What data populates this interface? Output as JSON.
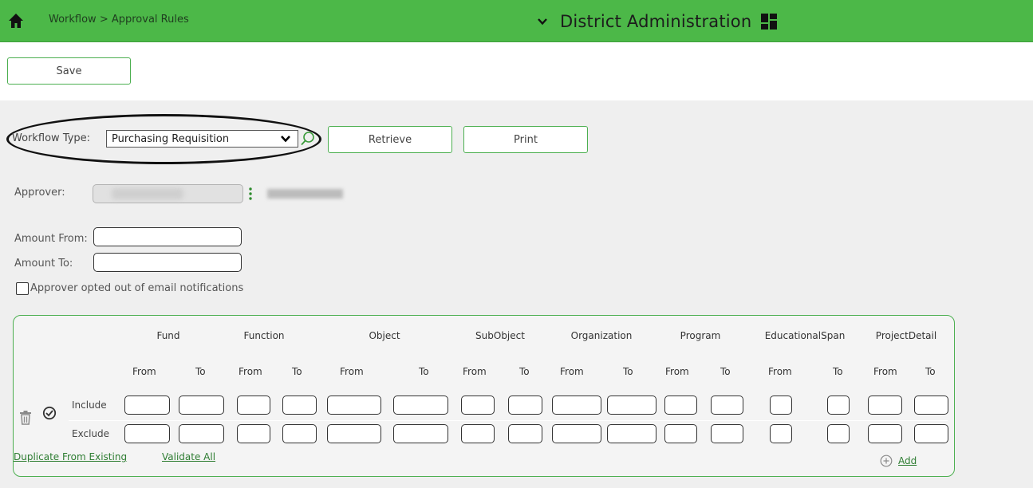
{
  "header": {
    "breadcrumb": "Workflow > Approval Rules",
    "app_title": "District Administration",
    "bg_color": "#4cb848"
  },
  "toolbar": {
    "save_label": "Save"
  },
  "filters": {
    "workflow_type_label": "Workflow Type:",
    "workflow_type_value": "Purchasing Requisition",
    "retrieve_label": "Retrieve",
    "print_label": "Print"
  },
  "form": {
    "approver_label": "Approver:",
    "amount_from_label": "Amount From:",
    "amount_to_label": "Amount To:",
    "optout_label": "Approver opted out of email notifications"
  },
  "rules_table": {
    "segments": [
      "Fund",
      "Function",
      "Object",
      "SubObject",
      "Organization",
      "Program",
      "EducationalSpan",
      "ProjectDetail"
    ],
    "from_label": "From",
    "to_label": "To",
    "row_labels": [
      "Include",
      "Exclude"
    ],
    "duplicate_link": "Duplicate From Existing",
    "validate_link": "Validate All",
    "add_label": "Add"
  },
  "icons": {
    "home": "home-icon",
    "app_switch": "chevron-down-icon",
    "menu": "grid-icon",
    "lookup": "magnifier-icon",
    "approver_menu": "kebab-icon",
    "delete": "trash-icon",
    "validate": "check-circle-icon",
    "add": "plus-circle-icon"
  },
  "colors": {
    "accent": "#4caf50",
    "link": "#2e7d32"
  }
}
